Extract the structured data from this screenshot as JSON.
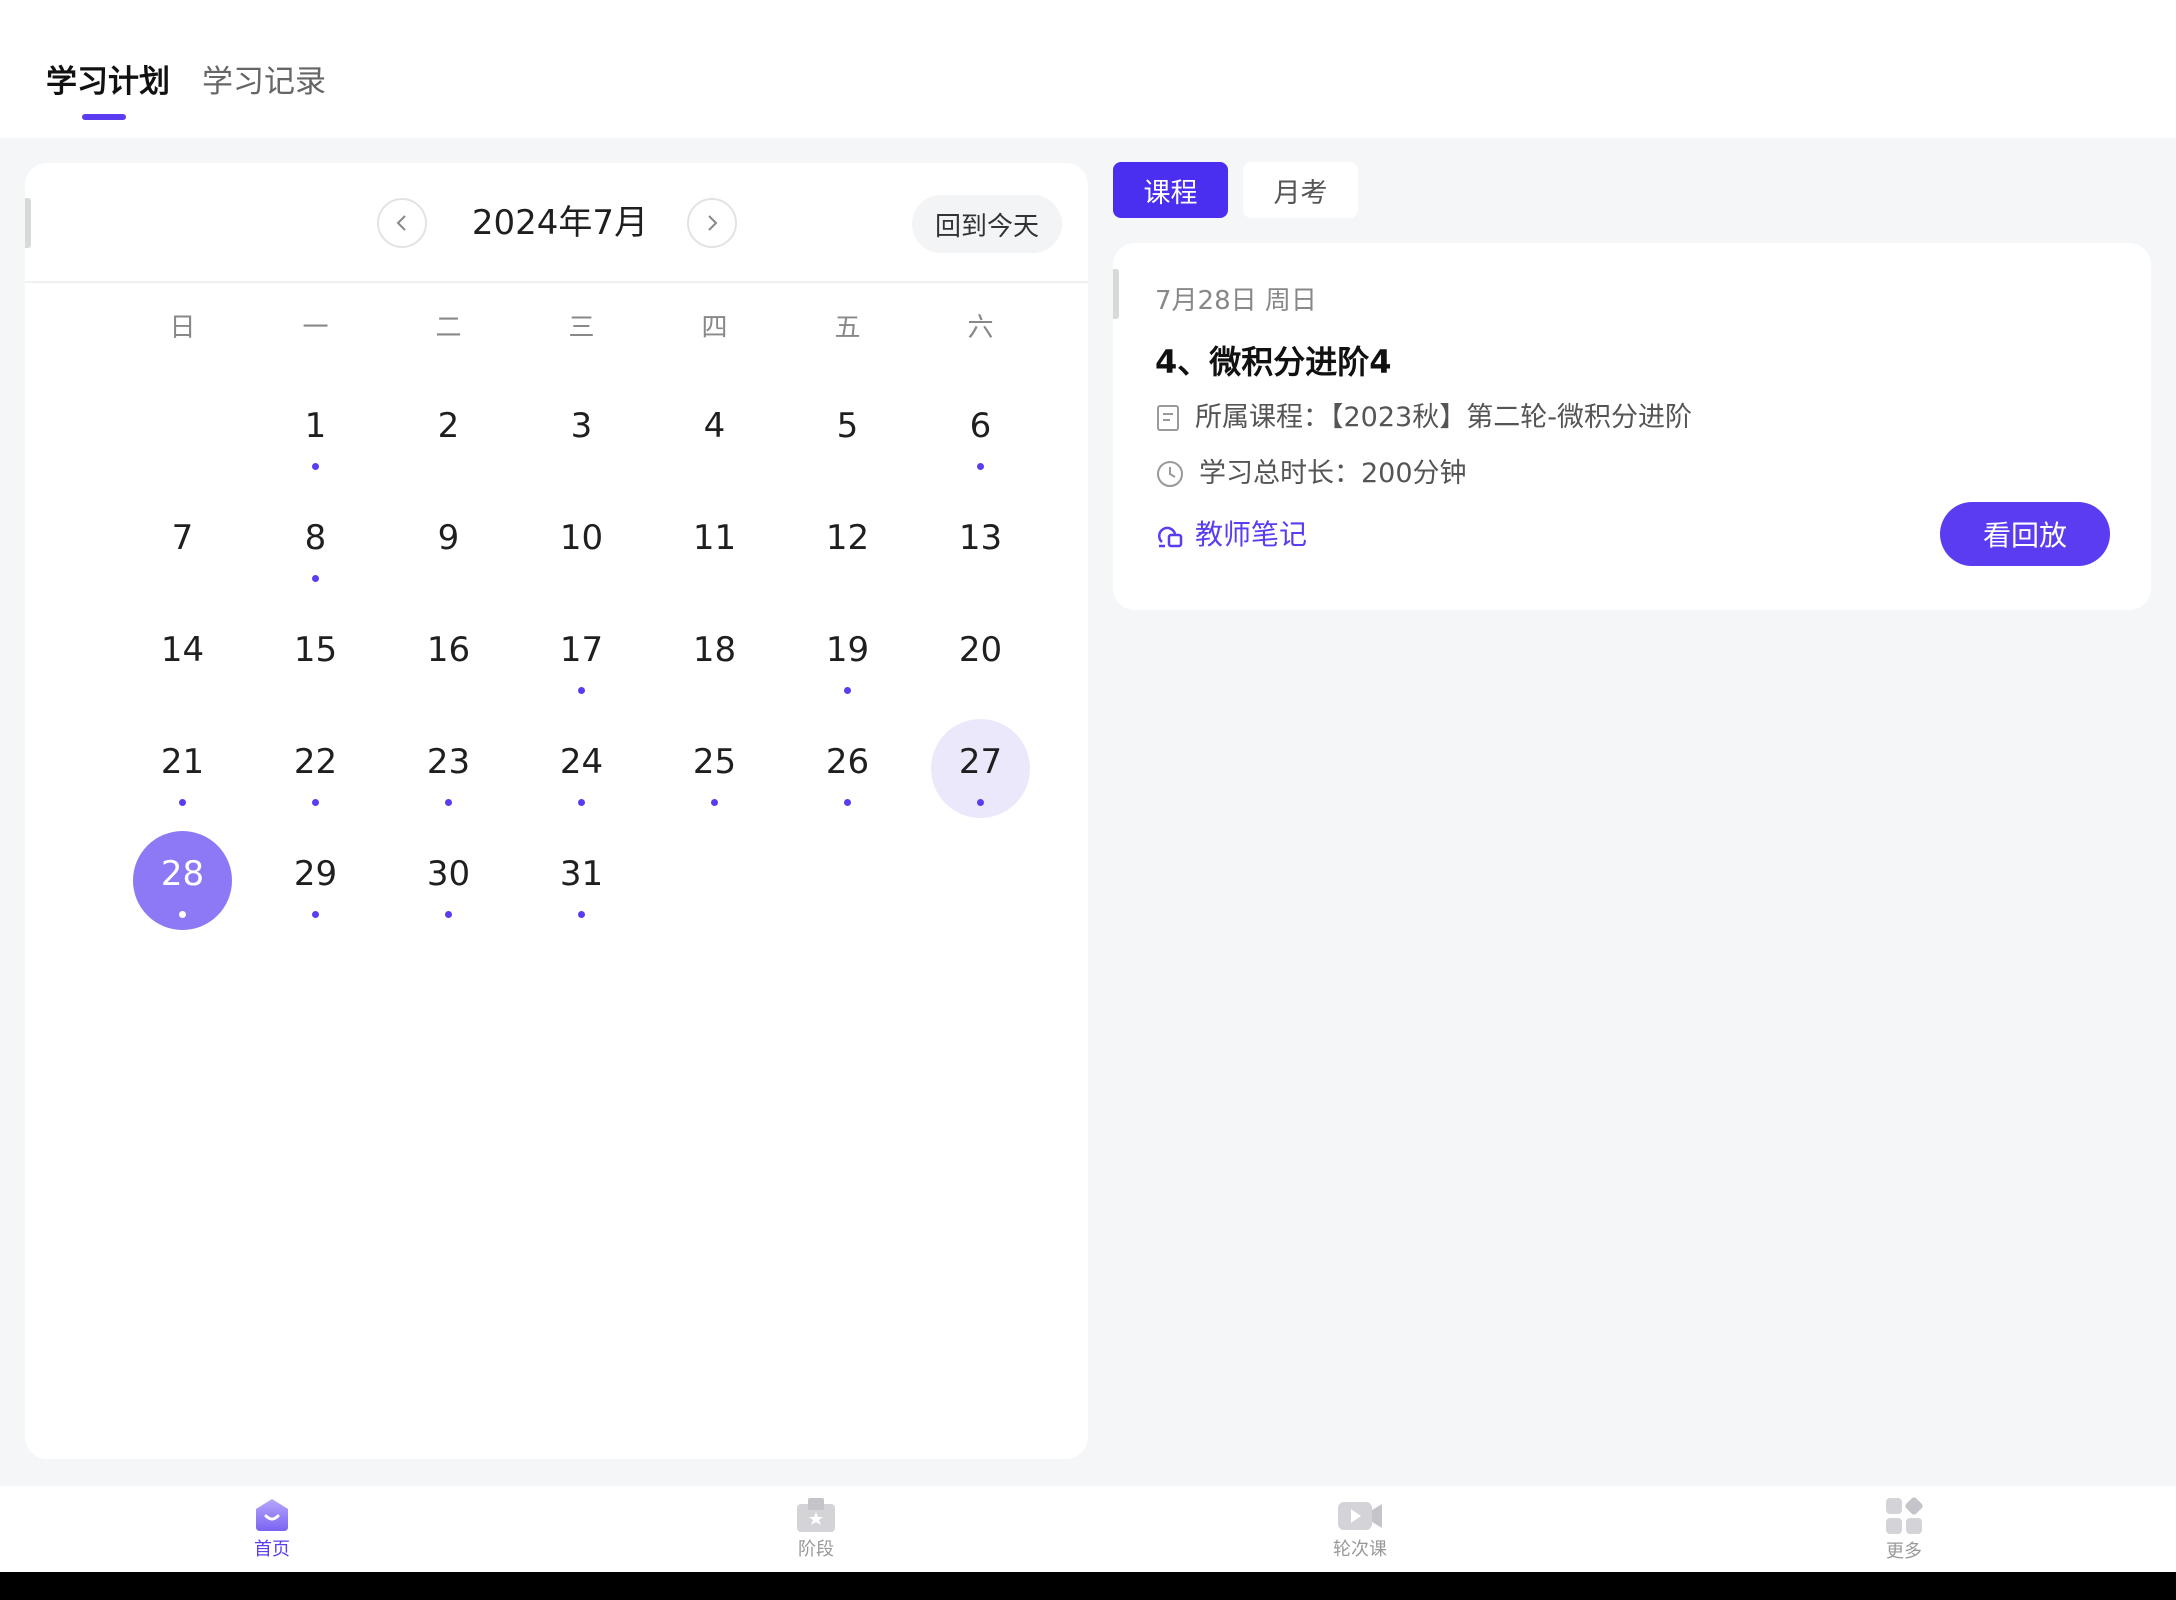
{
  "top_tabs": [
    {
      "label": "学习计划",
      "active": true
    },
    {
      "label": "学习记录",
      "active": false
    }
  ],
  "calendar": {
    "month_title": "2024年7月",
    "today_button": "回到今天",
    "weekdays": [
      "日",
      "一",
      "二",
      "三",
      "四",
      "五",
      "六"
    ],
    "leading_blanks": 1,
    "days": [
      {
        "n": "1",
        "dot": true
      },
      {
        "n": "2",
        "dot": false
      },
      {
        "n": "3",
        "dot": false
      },
      {
        "n": "4",
        "dot": false
      },
      {
        "n": "5",
        "dot": false
      },
      {
        "n": "6",
        "dot": true
      },
      {
        "n": "7",
        "dot": false
      },
      {
        "n": "8",
        "dot": true
      },
      {
        "n": "9",
        "dot": false
      },
      {
        "n": "10",
        "dot": false
      },
      {
        "n": "11",
        "dot": false
      },
      {
        "n": "12",
        "dot": false
      },
      {
        "n": "13",
        "dot": false
      },
      {
        "n": "14",
        "dot": false
      },
      {
        "n": "15",
        "dot": false
      },
      {
        "n": "16",
        "dot": false
      },
      {
        "n": "17",
        "dot": true
      },
      {
        "n": "18",
        "dot": false
      },
      {
        "n": "19",
        "dot": true
      },
      {
        "n": "20",
        "dot": false
      },
      {
        "n": "21",
        "dot": true
      },
      {
        "n": "22",
        "dot": true
      },
      {
        "n": "23",
        "dot": true
      },
      {
        "n": "24",
        "dot": true
      },
      {
        "n": "25",
        "dot": true
      },
      {
        "n": "26",
        "dot": true
      },
      {
        "n": "27",
        "dot": true,
        "today": true
      },
      {
        "n": "28",
        "dot": true,
        "selected": true
      },
      {
        "n": "29",
        "dot": true
      },
      {
        "n": "30",
        "dot": true
      },
      {
        "n": "31",
        "dot": true
      }
    ]
  },
  "segments": [
    {
      "label": "课程",
      "active": true
    },
    {
      "label": "月考",
      "active": false
    }
  ],
  "lesson": {
    "date": "7月28日 周日",
    "title": "4、微积分进阶4",
    "course": "所属课程：【2023秋】第二轮-微积分进阶",
    "duration": "学习总时长：200分钟",
    "notes_label": "教师笔记",
    "replay_label": "看回放"
  },
  "bottom_nav": [
    {
      "label": "首页",
      "icon": "home-icon",
      "active": true
    },
    {
      "label": "阶段",
      "icon": "stage-icon",
      "active": false
    },
    {
      "label": "轮次课",
      "icon": "video-icon",
      "active": false
    },
    {
      "label": "更多",
      "icon": "more-grid-icon",
      "active": false
    }
  ],
  "colors": {
    "accent": "#5b3cf0",
    "selected_day": "#8d79f5",
    "today_day": "#ece8fc"
  }
}
